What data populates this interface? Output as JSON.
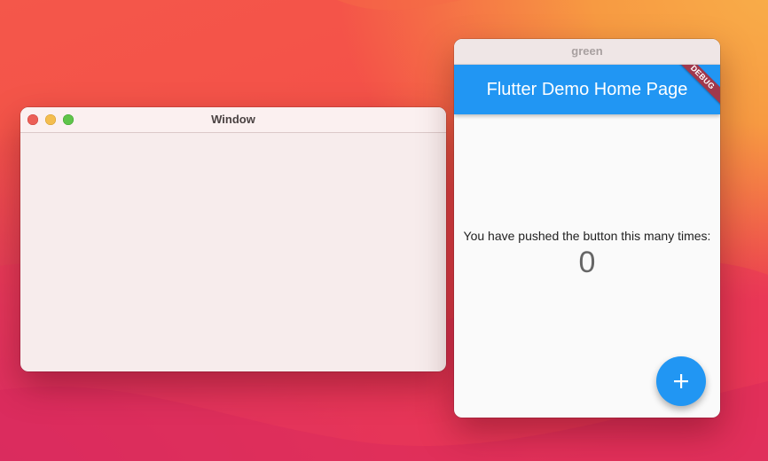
{
  "left_window": {
    "title": "Window"
  },
  "right_window": {
    "title": "green",
    "app_bar_title": "Flutter Demo Home Page",
    "debug_banner": "DEBUG",
    "counter_label": "You have pushed the button this many times:",
    "counter_value": "0",
    "fab_icon": "plus-icon"
  },
  "colors": {
    "app_bar": "#2196f3",
    "fab": "#2196f3",
    "debug_banner": "#a0384c",
    "traffic_close": "#ec5f57",
    "traffic_minimize": "#f4bd4f",
    "traffic_maximize": "#5fc44a"
  }
}
